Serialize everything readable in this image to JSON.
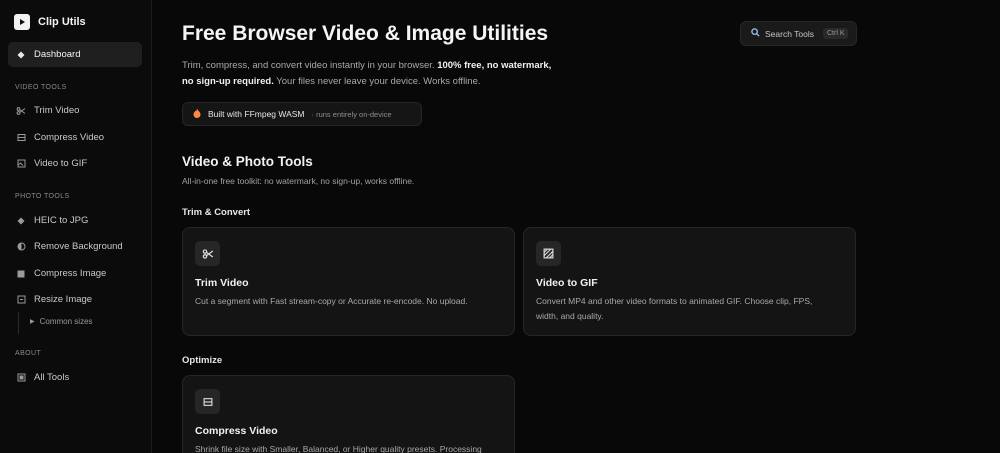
{
  "brand": {
    "title": "Clip Utils",
    "icon": "play-icon"
  },
  "sidebar": {
    "dashboard": {
      "label": "Dashboard",
      "icon": "diamond-icon"
    },
    "video_tools_label": "VIDEO TOOLS",
    "video_tools": [
      {
        "label": "Trim Video",
        "icon": "scissors-icon"
      },
      {
        "label": "Compress Video",
        "icon": "film-icon"
      },
      {
        "label": "Video to GIF",
        "icon": "image-icon"
      }
    ],
    "photo_tools_label": "PHOTO TOOLS",
    "photo_tools": [
      {
        "label": "HEIC to JPG",
        "icon": "diamond-icon"
      },
      {
        "label": "Remove Background",
        "icon": "half-circle-icon"
      },
      {
        "label": "Compress Image",
        "icon": "square-icon"
      },
      {
        "label": "Resize Image",
        "icon": "resize-icon"
      }
    ],
    "common_sizes": "Common sizes",
    "about_label": "ABOUT",
    "all_tools": {
      "label": "All Tools",
      "icon": "grid-icon"
    }
  },
  "header": {
    "title": "Free Browser Video & Image Utilities",
    "search_label": "Search Tools",
    "search_shortcut": "Ctrl K"
  },
  "intro": {
    "part1": "Trim, compress, and convert video instantly in your browser. ",
    "bold": "100% free, no watermark, no sign-up required.",
    "part2": " Your files never leave your device. Works offline."
  },
  "badge": {
    "label": "Built with FFmpeg WASM",
    "note": "· runs entirely on-device"
  },
  "tools_section": {
    "title": "Video & Photo Tools",
    "subtitle": "All-in-one free toolkit: no watermark, no sign-up, works offline."
  },
  "groups": {
    "trim_convert": "Trim & Convert",
    "optimize": "Optimize"
  },
  "cards": {
    "trim": {
      "title": "Trim Video",
      "desc": "Cut a segment with Fast stream-copy or Accurate re-encode. No upload.",
      "icon": "scissors-icon"
    },
    "gif": {
      "title": "Video to GIF",
      "desc": "Convert MP4 and other video formats to animated GIF. Choose clip, FPS, width, and quality.",
      "icon": "image-icon"
    },
    "compress": {
      "title": "Compress Video",
      "desc": "Shrink file size with Smaller, Balanced, or Higher quality presets. Processing",
      "icon": "film-icon"
    }
  }
}
